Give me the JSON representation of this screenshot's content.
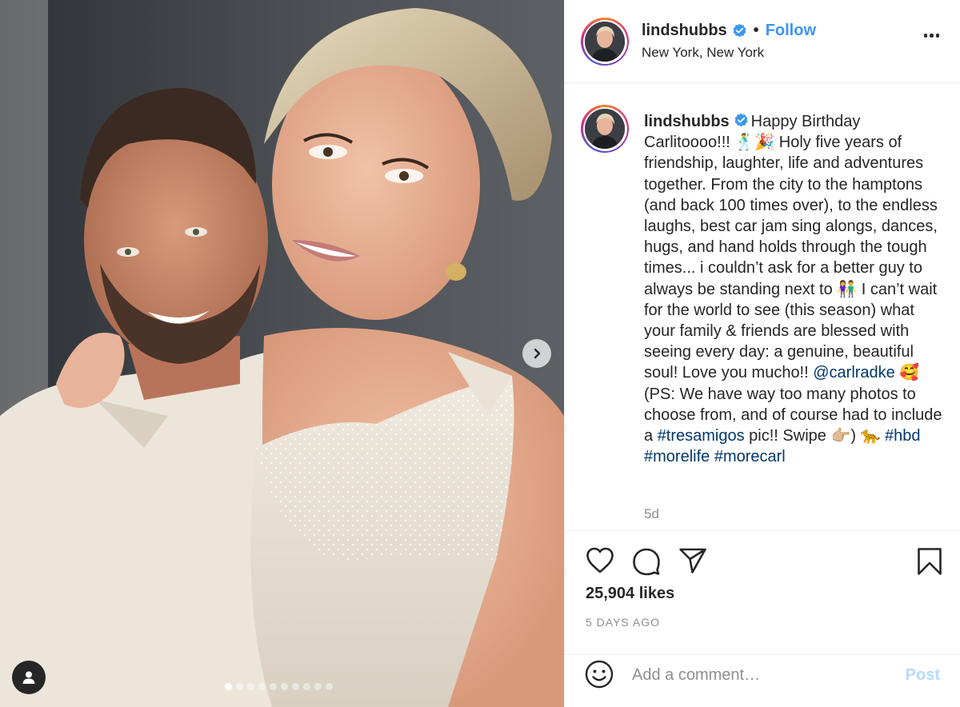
{
  "post": {
    "username": "lindshubbs",
    "follow_label": "Follow",
    "separator": "•",
    "location": "New York, New York",
    "caption_parts": {
      "p1": "Happy Birthday Carlitoooo!!! 🕺🎉 Holy five years of friendship, laughter, life and adventures together. From the city to the hamptons (and back 100 times over), to the endless laughs, best car jam sing alongs, dances, hugs, and hand holds through the tough times... i couldn’t ask for a better guy to always be standing next to 👫 I can’t wait for the world to see (this season) what your family & friends are blessed with seeing every day: a genuine, beautiful soul! Love you mucho!! ",
      "mention": "@carlradke",
      "p2": " 🥰 (PS: We have way too many photos to choose from, and of course had to include a ",
      "tag_tresamigos": "#tresamigos",
      "p3": " pic!! Swipe 👉🏼) 🐆 ",
      "tag_hbd": "#hbd",
      "tag_morelife": "#morelife",
      "tag_morecarl": "#morecarl"
    },
    "time_short": "5d",
    "likes": "25,904 likes",
    "time_long": "5 DAYS AGO"
  },
  "comment": {
    "placeholder": "Add a comment…",
    "post_label": "Post"
  },
  "carousel": {
    "total": 10,
    "active_index": 0
  },
  "colors": {
    "follow_blue": "#3b95f6",
    "link_blue": "#00376b",
    "post_disabled": "#b3dbff",
    "muted": "#8e8e8e",
    "verified_badge": "#3897f0"
  },
  "icons": [
    "heart-icon",
    "comment-icon",
    "share-icon",
    "bookmark-icon",
    "emoji-icon",
    "more-icon",
    "chevron-right-icon",
    "user-tag-icon",
    "verified-badge-icon"
  ]
}
